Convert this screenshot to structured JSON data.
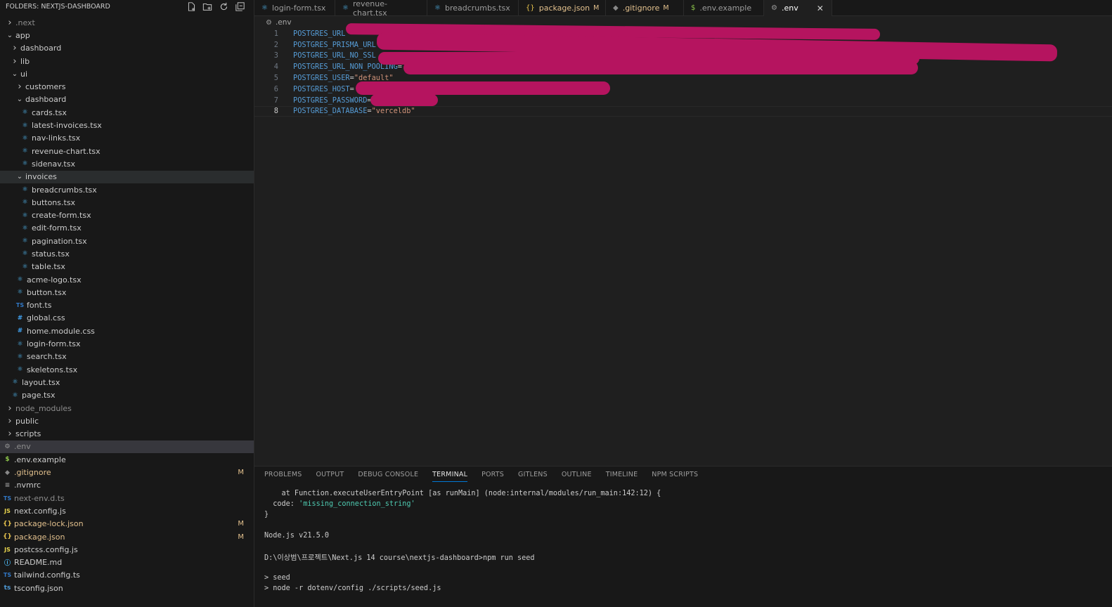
{
  "sidebar": {
    "header": "FOLDERS: NEXTJS-DASHBOARD",
    "actions": [
      "new-file-icon",
      "new-folder-icon",
      "refresh-icon",
      "collapse-icon"
    ],
    "items": [
      {
        "label": ".next",
        "indent": 0,
        "chev": "›",
        "kind": "folder",
        "dim": true
      },
      {
        "label": "app",
        "indent": 0,
        "chev": "⌄",
        "kind": "folder"
      },
      {
        "label": "dashboard",
        "indent": 1,
        "chev": "›",
        "kind": "folder"
      },
      {
        "label": "lib",
        "indent": 1,
        "chev": "›",
        "kind": "folder"
      },
      {
        "label": "ui",
        "indent": 1,
        "chev": "⌄",
        "kind": "folder"
      },
      {
        "label": "customers",
        "indent": 2,
        "chev": "›",
        "kind": "folder"
      },
      {
        "label": "dashboard",
        "indent": 2,
        "chev": "⌄",
        "kind": "folder"
      },
      {
        "label": "cards.tsx",
        "indent": 3,
        "icon": "react"
      },
      {
        "label": "latest-invoices.tsx",
        "indent": 3,
        "icon": "react"
      },
      {
        "label": "nav-links.tsx",
        "indent": 3,
        "icon": "react"
      },
      {
        "label": "revenue-chart.tsx",
        "indent": 3,
        "icon": "react"
      },
      {
        "label": "sidenav.tsx",
        "indent": 3,
        "icon": "react"
      },
      {
        "label": "invoices",
        "indent": 2,
        "chev": "⌄",
        "kind": "folder",
        "active": true
      },
      {
        "label": "breadcrumbs.tsx",
        "indent": 3,
        "icon": "react"
      },
      {
        "label": "buttons.tsx",
        "indent": 3,
        "icon": "react"
      },
      {
        "label": "create-form.tsx",
        "indent": 3,
        "icon": "react"
      },
      {
        "label": "edit-form.tsx",
        "indent": 3,
        "icon": "react"
      },
      {
        "label": "pagination.tsx",
        "indent": 3,
        "icon": "react"
      },
      {
        "label": "status.tsx",
        "indent": 3,
        "icon": "react"
      },
      {
        "label": "table.tsx",
        "indent": 3,
        "icon": "react"
      },
      {
        "label": "acme-logo.tsx",
        "indent": 2,
        "icon": "react"
      },
      {
        "label": "button.tsx",
        "indent": 2,
        "icon": "react"
      },
      {
        "label": "font.ts",
        "indent": 2,
        "icon": "ts"
      },
      {
        "label": "global.css",
        "indent": 2,
        "icon": "css"
      },
      {
        "label": "home.module.css",
        "indent": 2,
        "icon": "css"
      },
      {
        "label": "login-form.tsx",
        "indent": 2,
        "icon": "react"
      },
      {
        "label": "search.tsx",
        "indent": 2,
        "icon": "react"
      },
      {
        "label": "skeletons.tsx",
        "indent": 2,
        "icon": "react"
      },
      {
        "label": "layout.tsx",
        "indent": 1,
        "icon": "react"
      },
      {
        "label": "page.tsx",
        "indent": 1,
        "icon": "react"
      },
      {
        "label": "node_modules",
        "indent": 0,
        "chev": "›",
        "kind": "folder",
        "dim": true
      },
      {
        "label": "public",
        "indent": 0,
        "chev": "›",
        "kind": "folder"
      },
      {
        "label": "scripts",
        "indent": 0,
        "chev": "›",
        "kind": "folder"
      },
      {
        "label": ".env",
        "indent": -1,
        "icon": "env",
        "dim": true,
        "selected": true
      },
      {
        "label": ".env.example",
        "indent": -1,
        "icon": "dollar"
      },
      {
        "label": ".gitignore",
        "indent": -1,
        "icon": "git",
        "modified": true,
        "badge": "M"
      },
      {
        "label": ".nvmrc",
        "indent": -1,
        "icon": "list"
      },
      {
        "label": "next-env.d.ts",
        "indent": -1,
        "icon": "ts",
        "dim": true
      },
      {
        "label": "next.config.js",
        "indent": -1,
        "icon": "js"
      },
      {
        "label": "package-lock.json",
        "indent": -1,
        "icon": "json",
        "modified": true,
        "badge": "M"
      },
      {
        "label": "package.json",
        "indent": -1,
        "icon": "json",
        "modified": true,
        "badge": "M"
      },
      {
        "label": "postcss.config.js",
        "indent": -1,
        "icon": "js"
      },
      {
        "label": "README.md",
        "indent": -1,
        "icon": "info"
      },
      {
        "label": "tailwind.config.ts",
        "indent": -1,
        "icon": "ts"
      },
      {
        "label": "tsconfig.json",
        "indent": -1,
        "icon": "tsjson"
      }
    ]
  },
  "tabs": [
    {
      "label": "login-form.tsx",
      "icon": "react"
    },
    {
      "label": "revenue-chart.tsx",
      "icon": "react"
    },
    {
      "label": "breadcrumbs.tsx",
      "icon": "react"
    },
    {
      "label": "package.json",
      "icon": "json",
      "badge": "M",
      "modified": true
    },
    {
      "label": ".gitignore",
      "icon": "git",
      "badge": "M",
      "modified": true
    },
    {
      "label": ".env.example",
      "icon": "dollar"
    },
    {
      "label": ".env",
      "icon": "env",
      "active": true,
      "close": "✕"
    }
  ],
  "breadcrumb": ".env",
  "editor": {
    "lines": [
      {
        "num": "1",
        "key": "POSTGRES_URL",
        "value": ""
      },
      {
        "num": "2",
        "key": "POSTGRES_PRISMA_URL",
        "value": ""
      },
      {
        "num": "3",
        "key": "POSTGRES_URL_NO_SSL",
        "value": ""
      },
      {
        "num": "4",
        "key": "POSTGRES_URL_NON_POOLING",
        "value": "="
      },
      {
        "num": "5",
        "key": "POSTGRES_USER",
        "value": "=\"default\""
      },
      {
        "num": "6",
        "key": "POSTGRES_HOST",
        "value": "="
      },
      {
        "num": "7",
        "key": "POSTGRES_PASSWORD",
        "value": "="
      },
      {
        "num": "8",
        "key": "POSTGRES_DATABASE",
        "value": "=\"verceldb\"",
        "current": true
      }
    ]
  },
  "panel": {
    "tabs": [
      "PROBLEMS",
      "OUTPUT",
      "DEBUG CONSOLE",
      "TERMINAL",
      "PORTS",
      "GITLENS",
      "OUTLINE",
      "TIMELINE",
      "NPM SCRIPTS"
    ],
    "active_tab": "TERMINAL",
    "terminal": {
      "l1": "    at Function.executeUserEntryPoint [as runMain] (node:internal/modules/run_main:142:12) {",
      "l2a": "  code: ",
      "l2b": "'missing_connection_string'",
      "l3": "}",
      "l4": "",
      "l5": "Node.js v21.5.0",
      "l6": "",
      "l7": "D:\\이상범\\프로젝트\\Next.js 14 course\\nextjs-dashboard>npm run seed",
      "l8": "",
      "l9": "> seed",
      "l10": "> node -r dotenv/config ./scripts/seed.js"
    }
  },
  "colors": {
    "redaction": "#b5145f",
    "accent": "#0078d4",
    "modified": "#e2c08d"
  }
}
